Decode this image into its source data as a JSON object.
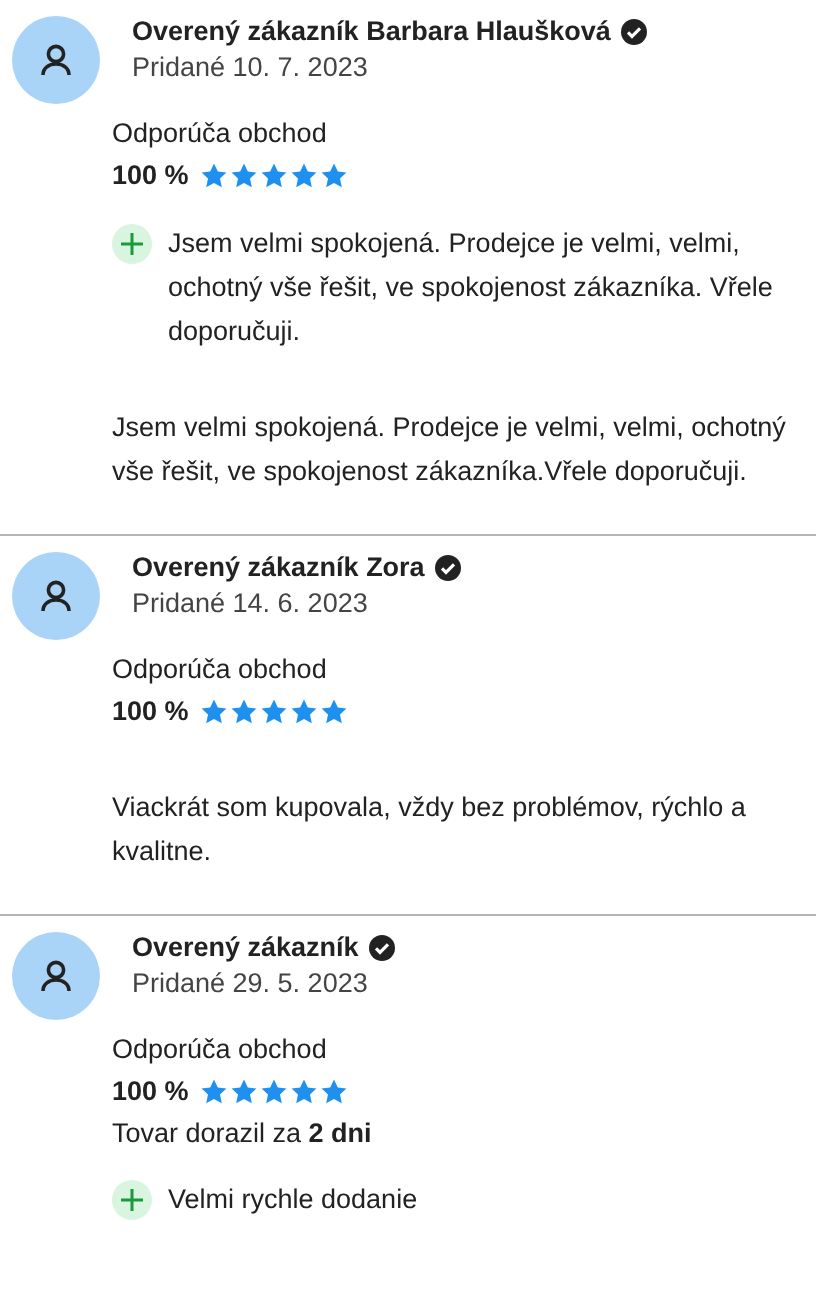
{
  "reviews": [
    {
      "name": "Overený zákazník Barbara Hlaušková",
      "verified": true,
      "date": "Pridané 10. 7. 2023",
      "recommend_label": "Odporúča obchod",
      "percent": "100 %",
      "stars": 5,
      "pros": [
        "Jsem velmi spokojená. Prodejce je velmi, velmi, ochotný vše řešit, ve spokojenost zákazníka. Vřele doporučuji."
      ],
      "comment": "Jsem velmi spokojená. Prodejce je velmi, velmi, ochotný vše řešit, ve spokojenost zákazníka.Vřele doporučuji."
    },
    {
      "name": "Overený zákazník Zora",
      "verified": true,
      "date": "Pridané 14. 6. 2023",
      "recommend_label": "Odporúča obchod",
      "percent": "100 %",
      "stars": 5,
      "comment": "Viackrát som kupovala, vždy bez problémov, rýchlo a kvalitne."
    },
    {
      "name": "Overený zákazník",
      "verified": true,
      "date": "Pridané 29. 5. 2023",
      "recommend_label": "Odporúča obchod",
      "percent": "100 %",
      "stars": 5,
      "delivery": "Tovar dorazil za **2 dni**",
      "pros": [
        "Velmi rychle dodanie"
      ]
    }
  ]
}
